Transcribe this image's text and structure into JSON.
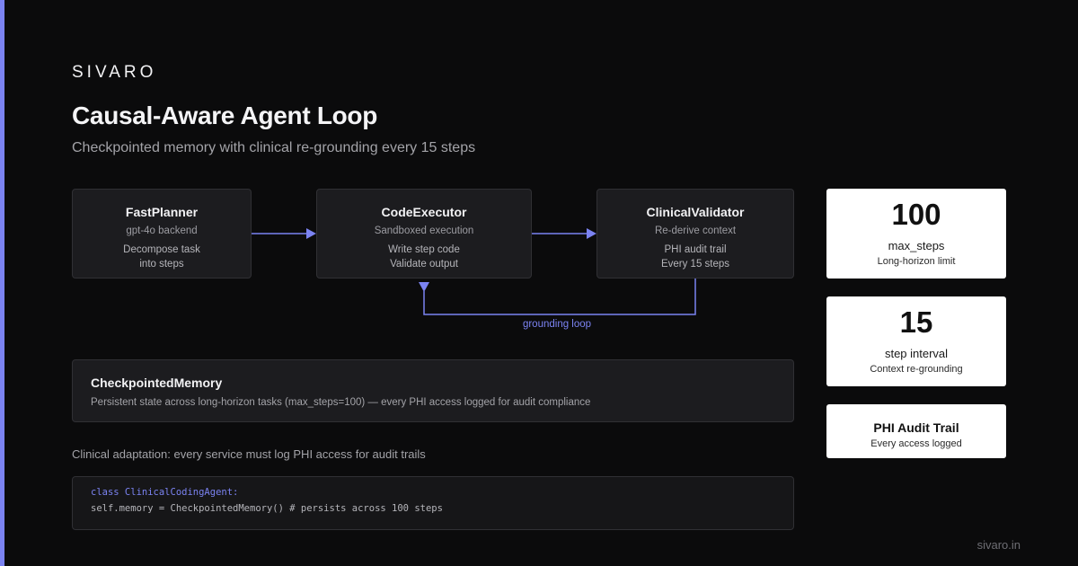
{
  "brand": "SIVARO",
  "title": "Causal-Aware Agent Loop",
  "subtitle": "Checkpointed memory with clinical re-grounding every 15 steps",
  "nodes": [
    {
      "name": "FastPlanner",
      "sub": "gpt-4o backend",
      "desc1": "Decompose task",
      "desc2": "into steps"
    },
    {
      "name": "CodeExecutor",
      "sub": "Sandboxed execution",
      "desc1": "Write step code",
      "desc2": "Validate output"
    },
    {
      "name": "ClinicalValidator",
      "sub": "Re-derive context",
      "desc1": "PHI audit trail",
      "desc2": "Every 15 steps"
    }
  ],
  "loop_label": "grounding loop",
  "memory": {
    "title": "CheckpointedMemory",
    "desc": "Persistent state across long-horizon tasks (max_steps=100) — every PHI access logged for audit compliance"
  },
  "clinical_note": "Clinical adaptation: every service must log PHI access for audit trails",
  "code": {
    "line1": "class ClinicalCodingAgent:",
    "line2": "self.memory = CheckpointedMemory() # persists across 100 steps"
  },
  "stats": [
    {
      "value": "100",
      "label": "max_steps",
      "caption": "Long-horizon limit"
    },
    {
      "value": "15",
      "label": "step interval",
      "caption": "Context re-grounding"
    },
    {
      "title": "PHI Audit Trail",
      "caption": "Every access logged"
    }
  ],
  "footer_url": "sivaro.in",
  "colors": {
    "accent": "#7b83f2",
    "background": "#0b0b0c",
    "card": "#1c1c1f"
  }
}
